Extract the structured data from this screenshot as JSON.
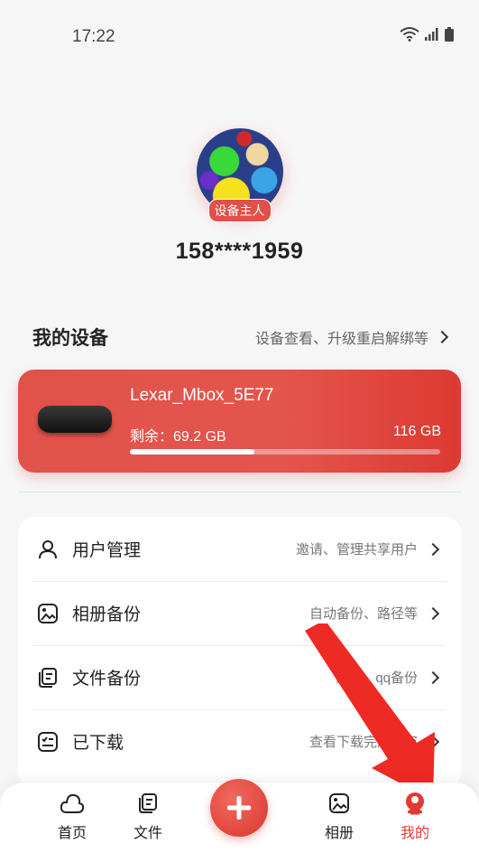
{
  "status_bar": {
    "time": "17:22"
  },
  "profile": {
    "badge": "设备主人",
    "phone": "158****1959"
  },
  "devices": {
    "title": "我的设备",
    "link": "设备查看、升级重启解绑等",
    "device": {
      "name": "Lexar_Mbox_5E77",
      "remaining": "剩余：69.2 GB",
      "total": "116 GB",
      "used_fraction": 0.4
    }
  },
  "menu": [
    {
      "label": "用户管理",
      "hint": "邀请、管理共享用户",
      "icon": "user-icon"
    },
    {
      "label": "相册备份",
      "hint": "自动备份、路径等",
      "icon": "photo-icon"
    },
    {
      "label": "文件备份",
      "hint": "微信、qq备份",
      "icon": "file-icon"
    },
    {
      "label": "已下载",
      "hint": "查看下载完成内容",
      "icon": "download-list-icon"
    }
  ],
  "tabbar": {
    "tabs": [
      {
        "label": "首页",
        "icon": "cloud-icon"
      },
      {
        "label": "文件",
        "icon": "file-icon"
      },
      {
        "label": "相册",
        "icon": "photo-icon"
      },
      {
        "label": "我的",
        "icon": "profile-icon",
        "active": true
      }
    ]
  },
  "colors": {
    "accent": "#e03a33",
    "card": "#e4554d"
  }
}
